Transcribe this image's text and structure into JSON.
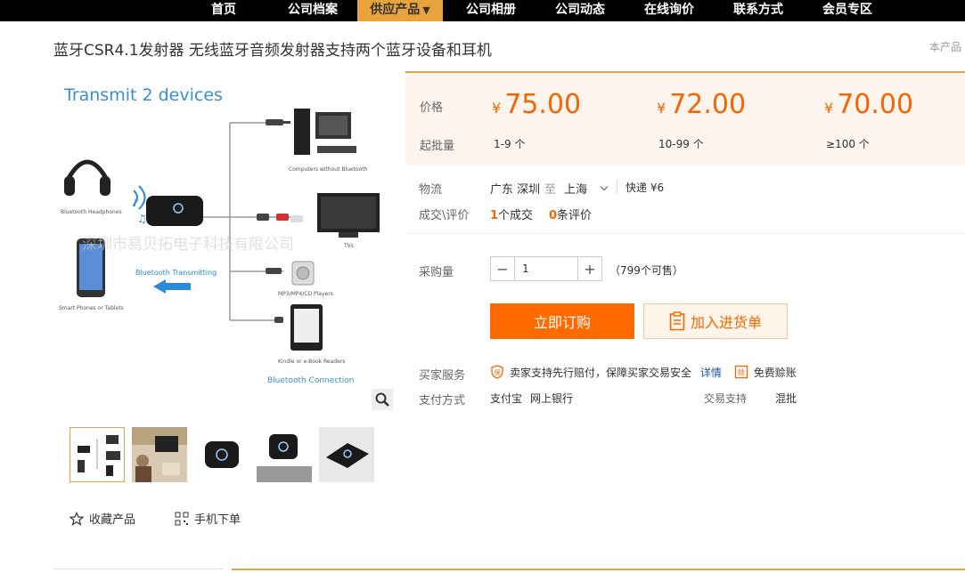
{
  "nav": {
    "items": [
      "首页",
      "公司档案",
      "供应产品",
      "公司相册",
      "公司动态",
      "在线询价",
      "联系方式",
      "会员专区"
    ],
    "active_arrow": "▼"
  },
  "product": {
    "title": "蓝牙CSR4.1发射器 无线蓝牙音频发射器支持两个蓝牙设备和耳机",
    "title_right": "本产品",
    "image_texts": {
      "headline": "Transmit 2 devices",
      "headphones": "Bluetooth Headphones",
      "phones": "Smart Phones or Tablets",
      "computers": "Computers without Bluetooth",
      "tv": "TVs",
      "mp3": "MP3/MP4/CD Players",
      "kindle": "Kindle or e-Book Readers",
      "transmitting": "Bluetooth Transmitting",
      "connection": "Bluetooth Connection",
      "watermark": "深圳市易贝拓电子科技有限公司"
    }
  },
  "price": {
    "label": "价格",
    "moq_label": "起批量",
    "currency": "¥",
    "tiers": [
      {
        "price": "75.00",
        "range": "1-9 个"
      },
      {
        "price": "72.00",
        "range": "10-99 个"
      },
      {
        "price": "70.00",
        "range": "≥100 个"
      }
    ]
  },
  "logistics": {
    "label": "物流",
    "from": "广东 深圳",
    "to_word": "至",
    "to": "上海",
    "express": "快递 ¥6"
  },
  "deals": {
    "label": "成交\\评价",
    "count": "1",
    "count_text": "个成交",
    "reviews": "0",
    "reviews_text": "条评价"
  },
  "order": {
    "label": "采购量",
    "minus": "−",
    "plus": "+",
    "quantity": "1",
    "stock": "（799个可售）",
    "buy_label": "立即订购",
    "cart_label": "加入进货单"
  },
  "service": {
    "label": "买家服务",
    "guarantee": "卖家支持先行赔付，保障买家交易安全",
    "details": "详情",
    "free": "免费赊账"
  },
  "payment": {
    "label": "支付方式",
    "methods": [
      "支付宝",
      "网上银行"
    ],
    "trade_label": "交易支持",
    "trade_value": "混批"
  },
  "utils": {
    "favorite": "收藏产品",
    "mobile": "手机下单"
  },
  "colors": {
    "accent": "#ff6a00",
    "price": "#f56600",
    "nav_active": "#e8a33d",
    "link": "#1d57a6"
  }
}
